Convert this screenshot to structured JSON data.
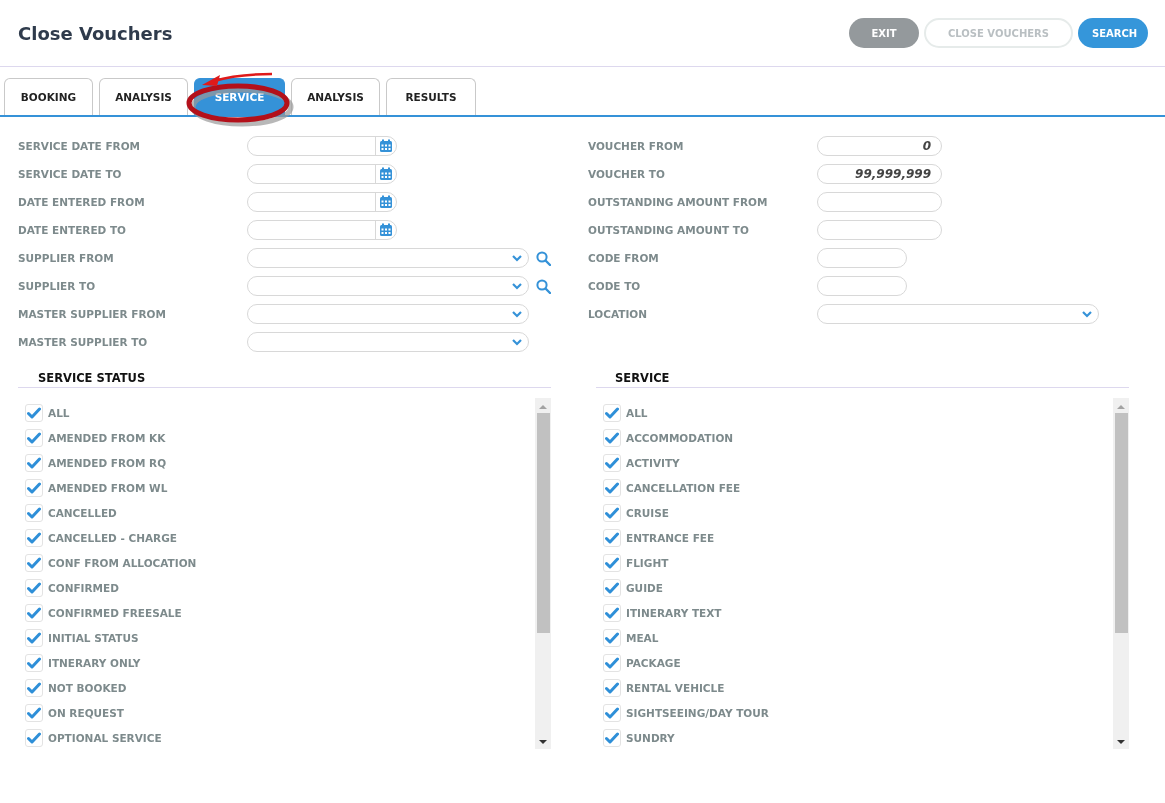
{
  "page": {
    "title": "Close Vouchers"
  },
  "buttons": [
    {
      "label": "EXIT",
      "kind": "secondary",
      "disabled": false
    },
    {
      "label": "CLOSE VOUCHERS",
      "kind": "outline",
      "disabled": true
    },
    {
      "label": "SEARCH",
      "kind": "primary",
      "disabled": false
    }
  ],
  "tabs": [
    {
      "label": "BOOKING",
      "selected": false
    },
    {
      "label": "ANALYSIS",
      "selected": false
    },
    {
      "label": "SERVICE",
      "selected": true
    },
    {
      "label": "ANALYSIS",
      "selected": false
    },
    {
      "label": "RESULTS",
      "selected": false
    }
  ],
  "filters_left": [
    {
      "label": "SERVICE DATE FROM",
      "kind": "date"
    },
    {
      "label": "SERVICE DATE TO",
      "kind": "date"
    },
    {
      "label": "DATE ENTERED FROM",
      "kind": "date"
    },
    {
      "label": "DATE ENTERED TO",
      "kind": "date"
    },
    {
      "label": "SUPPLIER FROM",
      "kind": "lookup"
    },
    {
      "label": "SUPPLIER TO",
      "kind": "lookup"
    },
    {
      "label": "MASTER SUPPLIER FROM",
      "kind": "select"
    },
    {
      "label": "MASTER SUPPLIER TO",
      "kind": "select"
    }
  ],
  "filters_right": [
    {
      "label": "VOUCHER FROM",
      "kind": "number",
      "value": "0"
    },
    {
      "label": "VOUCHER TO",
      "kind": "number",
      "value": "99,999,999"
    },
    {
      "label": "OUTSTANDING AMOUNT FROM",
      "kind": "number"
    },
    {
      "label": "OUTSTANDING AMOUNT TO",
      "kind": "number"
    },
    {
      "label": "CODE FROM",
      "kind": "code"
    },
    {
      "label": "CODE TO",
      "kind": "code"
    },
    {
      "label": "LOCATION",
      "kind": "select"
    }
  ],
  "service_status": {
    "title": "SERVICE STATUS",
    "items": [
      {
        "label": "ALL",
        "checked": true
      },
      {
        "label": "AMENDED FROM KK",
        "checked": true
      },
      {
        "label": "AMENDED FROM RQ",
        "checked": true
      },
      {
        "label": "AMENDED FROM WL",
        "checked": true
      },
      {
        "label": "CANCELLED",
        "checked": true
      },
      {
        "label": "CANCELLED - CHARGE",
        "checked": true
      },
      {
        "label": "CONF FROM ALLOCATION",
        "checked": true
      },
      {
        "label": "CONFIRMED",
        "checked": true
      },
      {
        "label": "CONFIRMED FREESALE",
        "checked": true
      },
      {
        "label": "INITIAL STATUS",
        "checked": true
      },
      {
        "label": "ITNERARY ONLY",
        "checked": true
      },
      {
        "label": "NOT BOOKED",
        "checked": true
      },
      {
        "label": "ON REQUEST",
        "checked": true
      },
      {
        "label": "OPTIONAL SERVICE",
        "checked": true
      }
    ]
  },
  "service": {
    "title": "SERVICE",
    "items": [
      {
        "label": "ALL",
        "checked": true
      },
      {
        "label": "ACCOMMODATION",
        "checked": true
      },
      {
        "label": "ACTIVITY",
        "checked": true
      },
      {
        "label": "CANCELLATION FEE",
        "checked": true
      },
      {
        "label": "CRUISE",
        "checked": true
      },
      {
        "label": "ENTRANCE FEE",
        "checked": true
      },
      {
        "label": "FLIGHT",
        "checked": true
      },
      {
        "label": "GUIDE",
        "checked": true
      },
      {
        "label": "ITINERARY TEXT",
        "checked": true
      },
      {
        "label": "MEAL",
        "checked": true
      },
      {
        "label": "PACKAGE",
        "checked": true
      },
      {
        "label": "RENTAL VEHICLE",
        "checked": true
      },
      {
        "label": "SIGHTSEEING/DAY TOUR",
        "checked": true
      },
      {
        "label": "SUNDRY",
        "checked": true
      }
    ]
  }
}
